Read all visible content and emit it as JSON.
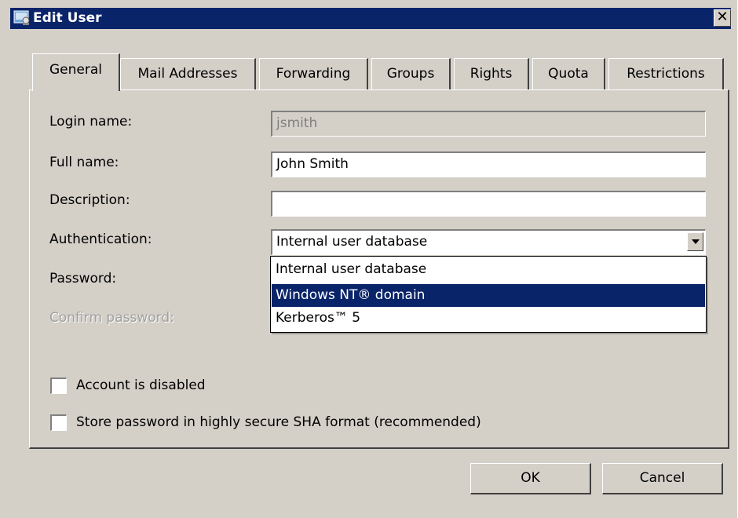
{
  "window": {
    "title": "Edit User",
    "close_glyph": "✕",
    "icon": "user-edit-icon"
  },
  "tabs": [
    {
      "label": "General",
      "active": true
    },
    {
      "label": "Mail Addresses",
      "active": false
    },
    {
      "label": "Forwarding",
      "active": false
    },
    {
      "label": "Groups",
      "active": false
    },
    {
      "label": "Rights",
      "active": false
    },
    {
      "label": "Quota",
      "active": false
    },
    {
      "label": "Restrictions",
      "active": false
    }
  ],
  "form": {
    "login_label": "Login name:",
    "login_value": "jsmith",
    "fullname_label": "Full name:",
    "fullname_value": "John Smith",
    "description_label": "Description:",
    "description_value": "",
    "auth_label": "Authentication:",
    "auth_value": "Internal user database",
    "password_label": "Password:",
    "confirm_label": "Confirm password:"
  },
  "auth_options": [
    {
      "label": "Internal user database",
      "selected": false
    },
    {
      "label": "Windows NT® domain",
      "selected": true
    },
    {
      "label": "Kerberos™ 5",
      "selected": false
    }
  ],
  "checkboxes": {
    "disabled_label": "Account is disabled",
    "disabled_checked": false,
    "sha_label": "Store password in highly secure SHA format (recommended)",
    "sha_checked": false
  },
  "buttons": {
    "ok": "OK",
    "cancel": "Cancel"
  },
  "colors": {
    "titlebar": "#0a246a",
    "dialog_bg": "#d4d0c8",
    "selection": "#0a246a"
  }
}
